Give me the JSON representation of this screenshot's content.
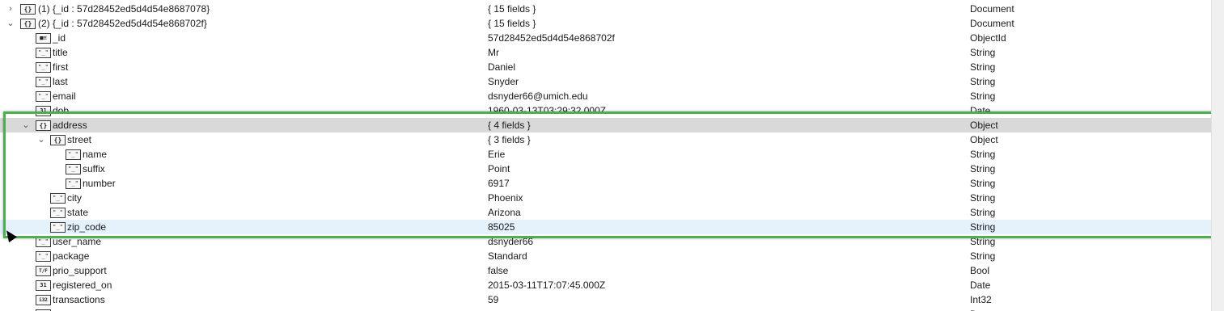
{
  "rows": [
    {
      "key": "(1) {_id : 57d28452ed5d4d54e8687078}",
      "value": "{ 15 fields }",
      "type": "Document"
    },
    {
      "key": "(2) {_id : 57d28452ed5d4d54e868702f}",
      "value": "{ 15 fields }",
      "type": "Document"
    },
    {
      "key": "_id",
      "value": "57d28452ed5d4d54e868702f",
      "type": "ObjectId"
    },
    {
      "key": "title",
      "value": "Mr",
      "type": "String"
    },
    {
      "key": "first",
      "value": "Daniel",
      "type": "String"
    },
    {
      "key": "last",
      "value": "Snyder",
      "type": "String"
    },
    {
      "key": "email",
      "value": "dsnyder66@umich.edu",
      "type": "String"
    },
    {
      "key": "dob",
      "value": "1960-03-13T03:29:32.000Z",
      "type": "Date"
    },
    {
      "key": "address",
      "value": "{ 4 fields }",
      "type": "Object"
    },
    {
      "key": "street",
      "value": "{ 3 fields }",
      "type": "Object"
    },
    {
      "key": "name",
      "value": "Erie",
      "type": "String"
    },
    {
      "key": "suffix",
      "value": "Point",
      "type": "String"
    },
    {
      "key": "number",
      "value": "6917",
      "type": "String"
    },
    {
      "key": "city",
      "value": "Phoenix",
      "type": "String"
    },
    {
      "key": "state",
      "value": "Arizona",
      "type": "String"
    },
    {
      "key": "zip_code",
      "value": "85025",
      "type": "String"
    },
    {
      "key": "user_name",
      "value": "dsnyder66",
      "type": "String"
    },
    {
      "key": "package",
      "value": "Standard",
      "type": "String"
    },
    {
      "key": "prio_support",
      "value": "false",
      "type": "Bool"
    },
    {
      "key": "registered_on",
      "value": "2015-03-11T17:07:45.000Z",
      "type": "Date"
    },
    {
      "key": "transactions",
      "value": "59",
      "type": "Int32"
    },
    {
      "key": "",
      "value": "",
      "type": "Date"
    }
  ],
  "icons": [
    "expand-chevron-icon",
    "collapse-chevron-icon",
    "object-icon",
    "string-icon",
    "objectid-icon",
    "date-icon",
    "bool-icon",
    "int32-icon"
  ],
  "colors": {
    "highlight_border": "#4cb050",
    "selected_row": "#d9d9d9",
    "hover_row": "#e5f1fb"
  }
}
